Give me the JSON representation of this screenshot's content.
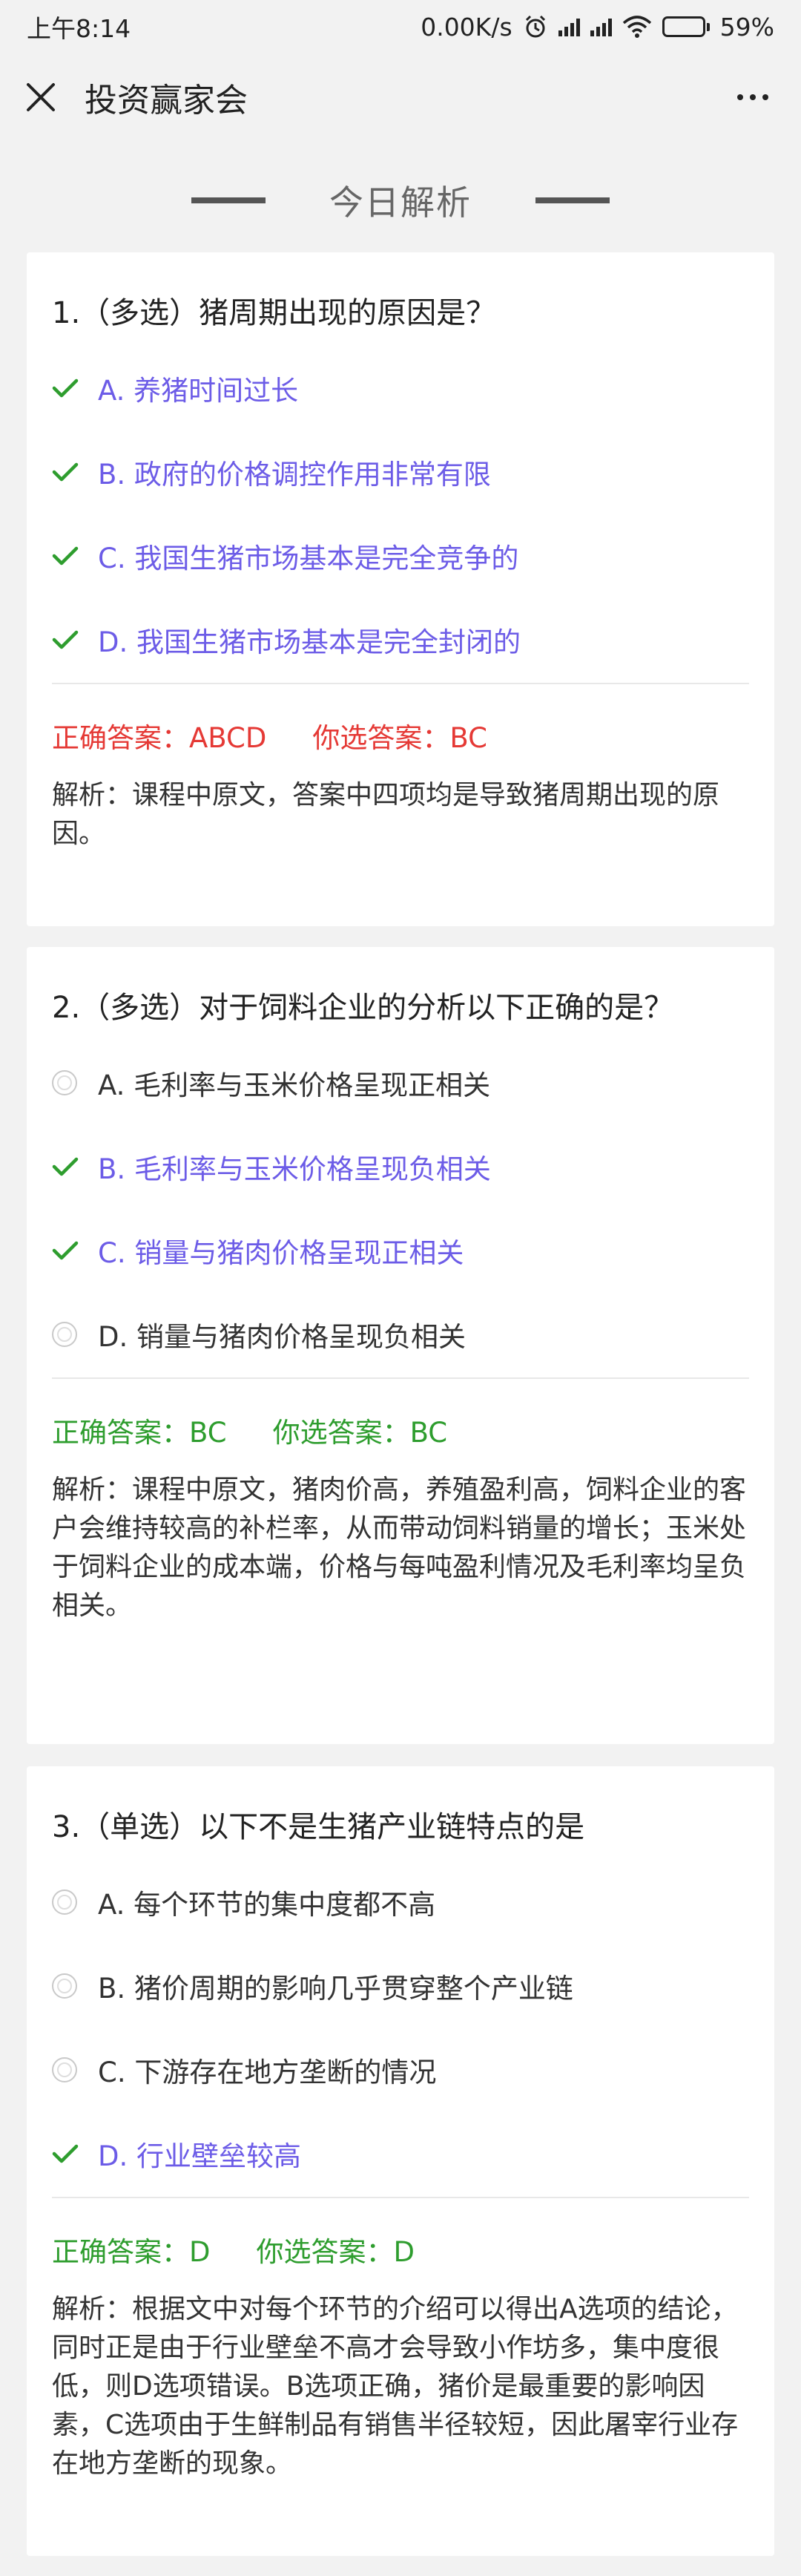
{
  "status_bar": {
    "time": "上午8:14",
    "speed": "0.00K/s",
    "battery": "59%",
    "battery_level": 0.59
  },
  "nav": {
    "title": "投资赢家会"
  },
  "section": {
    "title": "今日解析"
  },
  "colors": {
    "selected": "#6c5ce7",
    "check": "#2e9d2e",
    "wrong": "#e53935",
    "right": "#2e9d2e"
  },
  "questions": [
    {
      "title": "1.（多选）猪周期出现的原因是？",
      "options": [
        {
          "label": "A. 养猪时间过长",
          "selected": true
        },
        {
          "label": "B. 政府的价格调控作用非常有限",
          "selected": true
        },
        {
          "label": "C. 我国生猪市场基本是完全竞争的",
          "selected": true
        },
        {
          "label": "D. 我国生猪市场基本是完全封闭的",
          "selected": true
        }
      ],
      "correct_answer": "正确答案：ABCD",
      "your_answer": "你选答案：BC",
      "is_correct": false,
      "analysis": "解析：课程中原文，答案中四项均是导致猪周期出现的原因。"
    },
    {
      "title": "2.（多选）对于饲料企业的分析以下正确的是？",
      "options": [
        {
          "label": "A. 毛利率与玉米价格呈现正相关",
          "selected": false
        },
        {
          "label": "B. 毛利率与玉米价格呈现负相关",
          "selected": true
        },
        {
          "label": "C. 销量与猪肉价格呈现正相关",
          "selected": true
        },
        {
          "label": "D. 销量与猪肉价格呈现负相关",
          "selected": false
        }
      ],
      "correct_answer": "正确答案：BC",
      "your_answer": "你选答案：BC",
      "is_correct": true,
      "analysis": "解析：课程中原文，猪肉价高，养殖盈利高，饲料企业的客户会维持较高的补栏率，从而带动饲料销量的增长；玉米处于饲料企业的成本端，价格与每吨盈利情况及毛利率均呈负相关。"
    },
    {
      "title": "3.（单选）以下不是生猪产业链特点的是",
      "options": [
        {
          "label": "A. 每个环节的集中度都不高",
          "selected": false
        },
        {
          "label": "B. 猪价周期的影响几乎贯穿整个产业链",
          "selected": false
        },
        {
          "label": "C. 下游存在地方垄断的情况",
          "selected": false
        },
        {
          "label": "D. 行业壁垒较高",
          "selected": true
        }
      ],
      "correct_answer": "正确答案：D",
      "your_answer": "你选答案：D",
      "is_correct": true,
      "analysis": "解析：根据文中对每个环节的介绍可以得出A选项的结论，同时正是由于行业壁垒不高才会导致小作坊多，集中度很低，则D选项错误。B选项正确，猪价是最重要的影响因素，C选项由于生鲜制品有销售半径较短，因此屠宰行业存在地方垄断的现象。"
    }
  ]
}
